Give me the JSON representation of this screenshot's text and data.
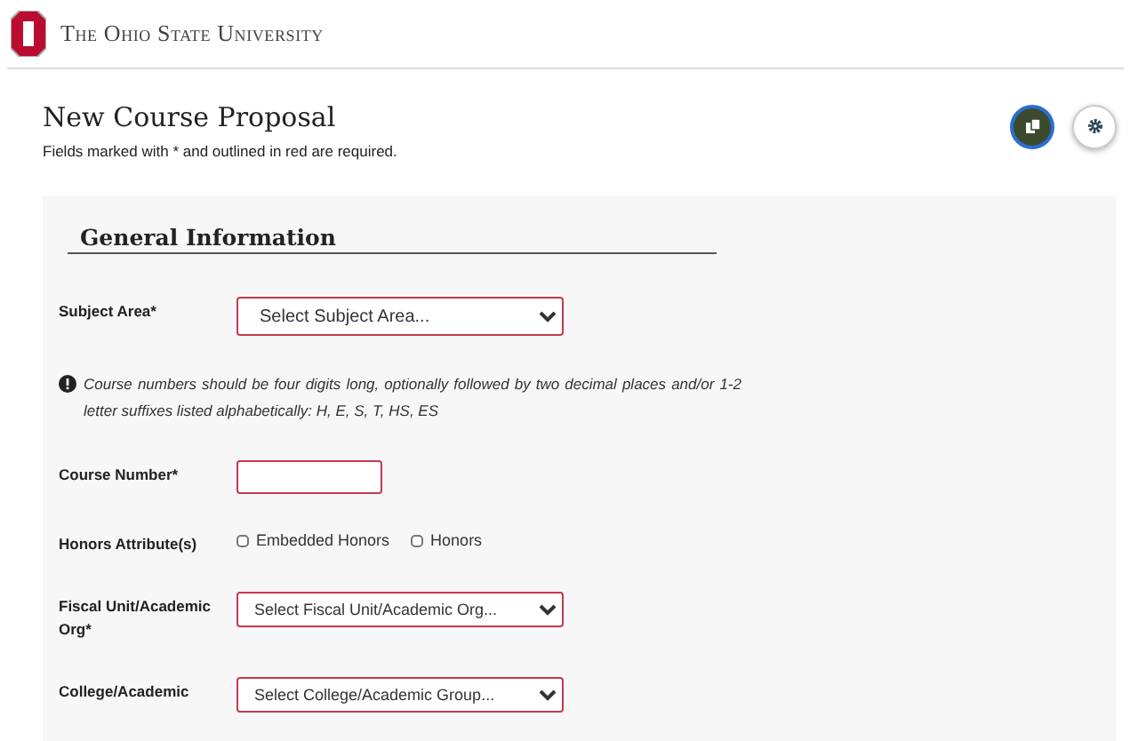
{
  "header": {
    "university": "The Ohio State University"
  },
  "page": {
    "title": "New Course Proposal",
    "subtitle": "Fields marked with * and outlined in red are required."
  },
  "section": {
    "title": "General Information"
  },
  "fields": [
    {
      "kind": "select",
      "label": "Subject Area*",
      "placeholder": "Select Subject Area...",
      "required": true
    },
    {
      "kind": "note",
      "text": "Course numbers should be four digits long, optionally followed by two decimal places and/or 1-2 letter suffixes listed alphabetically: H, E, S, T, HS, ES"
    },
    {
      "kind": "text",
      "label": "Course Number*",
      "required": true
    },
    {
      "kind": "checkboxes",
      "label": "Honors Attribute(s)",
      "options": [
        {
          "label": "Embedded Honors",
          "checked": false
        },
        {
          "label": "Honors",
          "checked": false
        }
      ]
    },
    {
      "kind": "select",
      "label": "Fiscal Unit/Academic Org*",
      "placeholder": "Select Fiscal Unit/Academic Org...",
      "required": true
    },
    {
      "kind": "select",
      "label": "College/Academic",
      "placeholder": "Select College/Academic Group...",
      "required": true
    }
  ]
}
